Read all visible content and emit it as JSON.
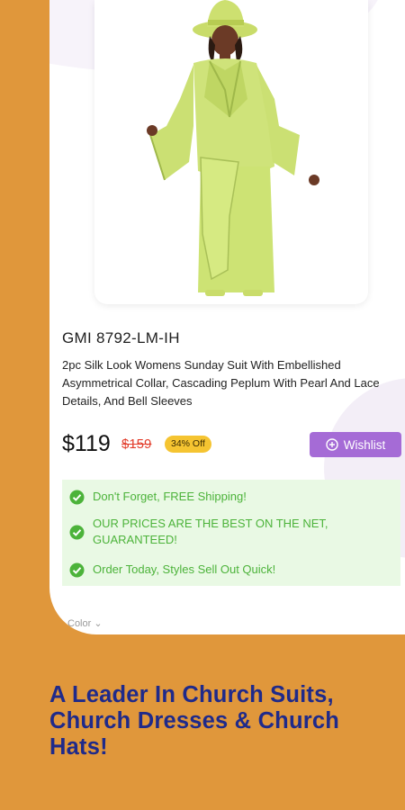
{
  "product": {
    "sku": "GMI 8792-LM-IH",
    "description": "2pc Silk Look Womens Sunday Suit With Embellished Asymmetrical Collar, Cascading Peplum With Pearl And Lace Details, And Bell Sleeves",
    "price": "$119",
    "original_price": "$159",
    "discount_badge": "34% Off",
    "wishlist_label": "Wishlist"
  },
  "perks": [
    {
      "text": "Don't Forget, FREE Shipping!"
    },
    {
      "text": "OUR PRICES ARE THE BEST ON THE NET, GUARANTEED!"
    },
    {
      "text": "Order Today, Styles Sell Out Quick!"
    }
  ],
  "selector_peek": "Color",
  "promo_headline": "A Leader In Church Suits, Church Dresses & Church Hats!",
  "colors": {
    "background": "#E0973B",
    "wishlist": "#A56BD6",
    "check": "#4CB33A",
    "headline": "#1F2A8A",
    "discount": "#F5C431"
  },
  "icons": {
    "wishlist": "plus-circle-icon",
    "perk": "check-circle-icon"
  }
}
